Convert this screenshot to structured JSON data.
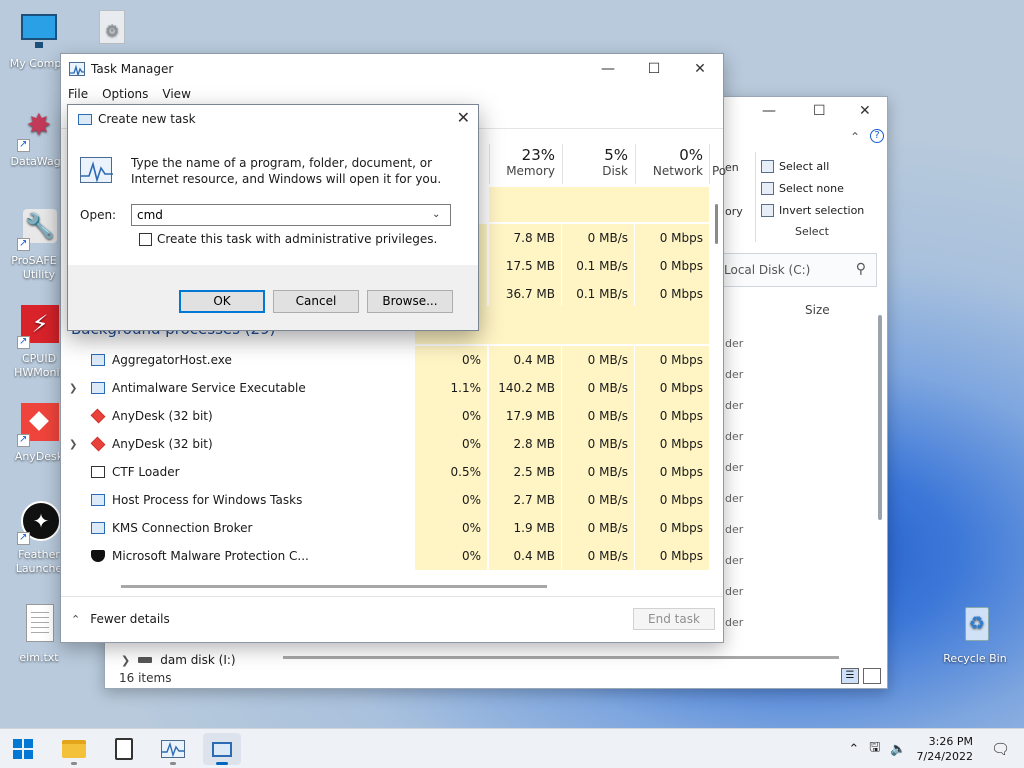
{
  "desktop": {
    "icons": [
      {
        "label": "My Compu"
      },
      {
        "label": "DataWago"
      },
      {
        "label": "ProSAFE P"
      },
      {
        "label": "Utility"
      },
      {
        "label": "CPUID"
      },
      {
        "label": "HWMonit"
      },
      {
        "label": "AnyDesk"
      },
      {
        "label": "Feather"
      },
      {
        "label": "Launche"
      },
      {
        "label": "eim.txt"
      },
      {
        "label": "Recycle Bin"
      }
    ]
  },
  "explorer": {
    "ribbon": {
      "select_all": "Select all",
      "select_none": "Select none",
      "invert_selection": "Invert selection",
      "group_label": "Select"
    },
    "ribbon_fragments": [
      "en",
      "ory"
    ],
    "search_placeholder": "Local Disk (C:)",
    "size_header": "Size",
    "row_fragment": "der",
    "drive_item": "dam disk (I:)",
    "item_count": "16 items"
  },
  "taskmanager": {
    "title": "Task Manager",
    "menu": [
      "File",
      "Options",
      "View"
    ],
    "columns": {
      "memory": {
        "pct": "23%",
        "name": "Memory"
      },
      "disk": {
        "pct": "5%",
        "name": "Disk"
      },
      "network": {
        "pct": "0%",
        "name": "Network"
      },
      "power_fragment": "Po"
    },
    "hidden_rows": [
      {
        "mem": "7.8 MB",
        "disk": "0 MB/s",
        "net": "0 Mbps"
      },
      {
        "mem": "17.5 MB",
        "disk": "0.1 MB/s",
        "net": "0 Mbps"
      },
      {
        "mem": "36.7 MB",
        "disk": "0.1 MB/s",
        "net": "0 Mbps"
      }
    ],
    "section_label": "Background processes (29)",
    "processes": [
      {
        "name": "AggregatorHost.exe",
        "cpu": "0%",
        "mem": "0.4 MB",
        "disk": "0 MB/s",
        "net": "0 Mbps",
        "expand": false,
        "icon": "app"
      },
      {
        "name": "Antimalware Service Executable",
        "cpu": "1.1%",
        "mem": "140.2 MB",
        "disk": "0 MB/s",
        "net": "0 Mbps",
        "expand": true,
        "icon": "app"
      },
      {
        "name": "AnyDesk (32 bit)",
        "cpu": "0%",
        "mem": "17.9 MB",
        "disk": "0 MB/s",
        "net": "0 Mbps",
        "expand": false,
        "icon": "anydesk"
      },
      {
        "name": "AnyDesk (32 bit)",
        "cpu": "0%",
        "mem": "2.8 MB",
        "disk": "0 MB/s",
        "net": "0 Mbps",
        "expand": true,
        "icon": "anydesk"
      },
      {
        "name": "CTF Loader",
        "cpu": "0.5%",
        "mem": "2.5 MB",
        "disk": "0 MB/s",
        "net": "0 Mbps",
        "expand": false,
        "icon": "pen"
      },
      {
        "name": "Host Process for Windows Tasks",
        "cpu": "0%",
        "mem": "2.7 MB",
        "disk": "0 MB/s",
        "net": "0 Mbps",
        "expand": false,
        "icon": "app"
      },
      {
        "name": "KMS Connection Broker",
        "cpu": "0%",
        "mem": "1.9 MB",
        "disk": "0 MB/s",
        "net": "0 Mbps",
        "expand": false,
        "icon": "app"
      },
      {
        "name": "Microsoft Malware Protection C...",
        "cpu": "0%",
        "mem": "0.4 MB",
        "disk": "0 MB/s",
        "net": "0 Mbps",
        "expand": false,
        "icon": "shield"
      }
    ],
    "fewer_details": "Fewer details",
    "end_task": "End task"
  },
  "run_dialog": {
    "title": "Create new task",
    "description": "Type the name of a program, folder, document, or Internet resource, and Windows will open it for you.",
    "open_label": "Open:",
    "input_value": "cmd",
    "admin_checkbox": "Create this task with administrative privileges.",
    "ok": "OK",
    "cancel": "Cancel",
    "browse": "Browse..."
  },
  "taskbar": {
    "time": "3:26 PM",
    "date": "7/24/2022"
  }
}
